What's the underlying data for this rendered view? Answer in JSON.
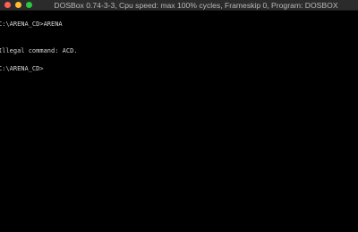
{
  "window": {
    "title": "DOSBox 0.74-3-3, Cpu speed: max 100% cycles, Frameskip  0, Program:   DOSBOX"
  },
  "titlebar": {
    "buttons": [
      {
        "icon": "close-icon",
        "color": "#ff5f57"
      },
      {
        "icon": "minimize-icon",
        "color": "#febc2e"
      },
      {
        "icon": "zoom-icon",
        "color": "#28c840"
      }
    ]
  },
  "console": {
    "lines": [
      "C:\\ARENA_CD>ARENA",
      "Illegal command: ACD.",
      "C:\\ARENA_CD>"
    ],
    "text_color": "#d8d8d8",
    "background_color": "#000000"
  }
}
